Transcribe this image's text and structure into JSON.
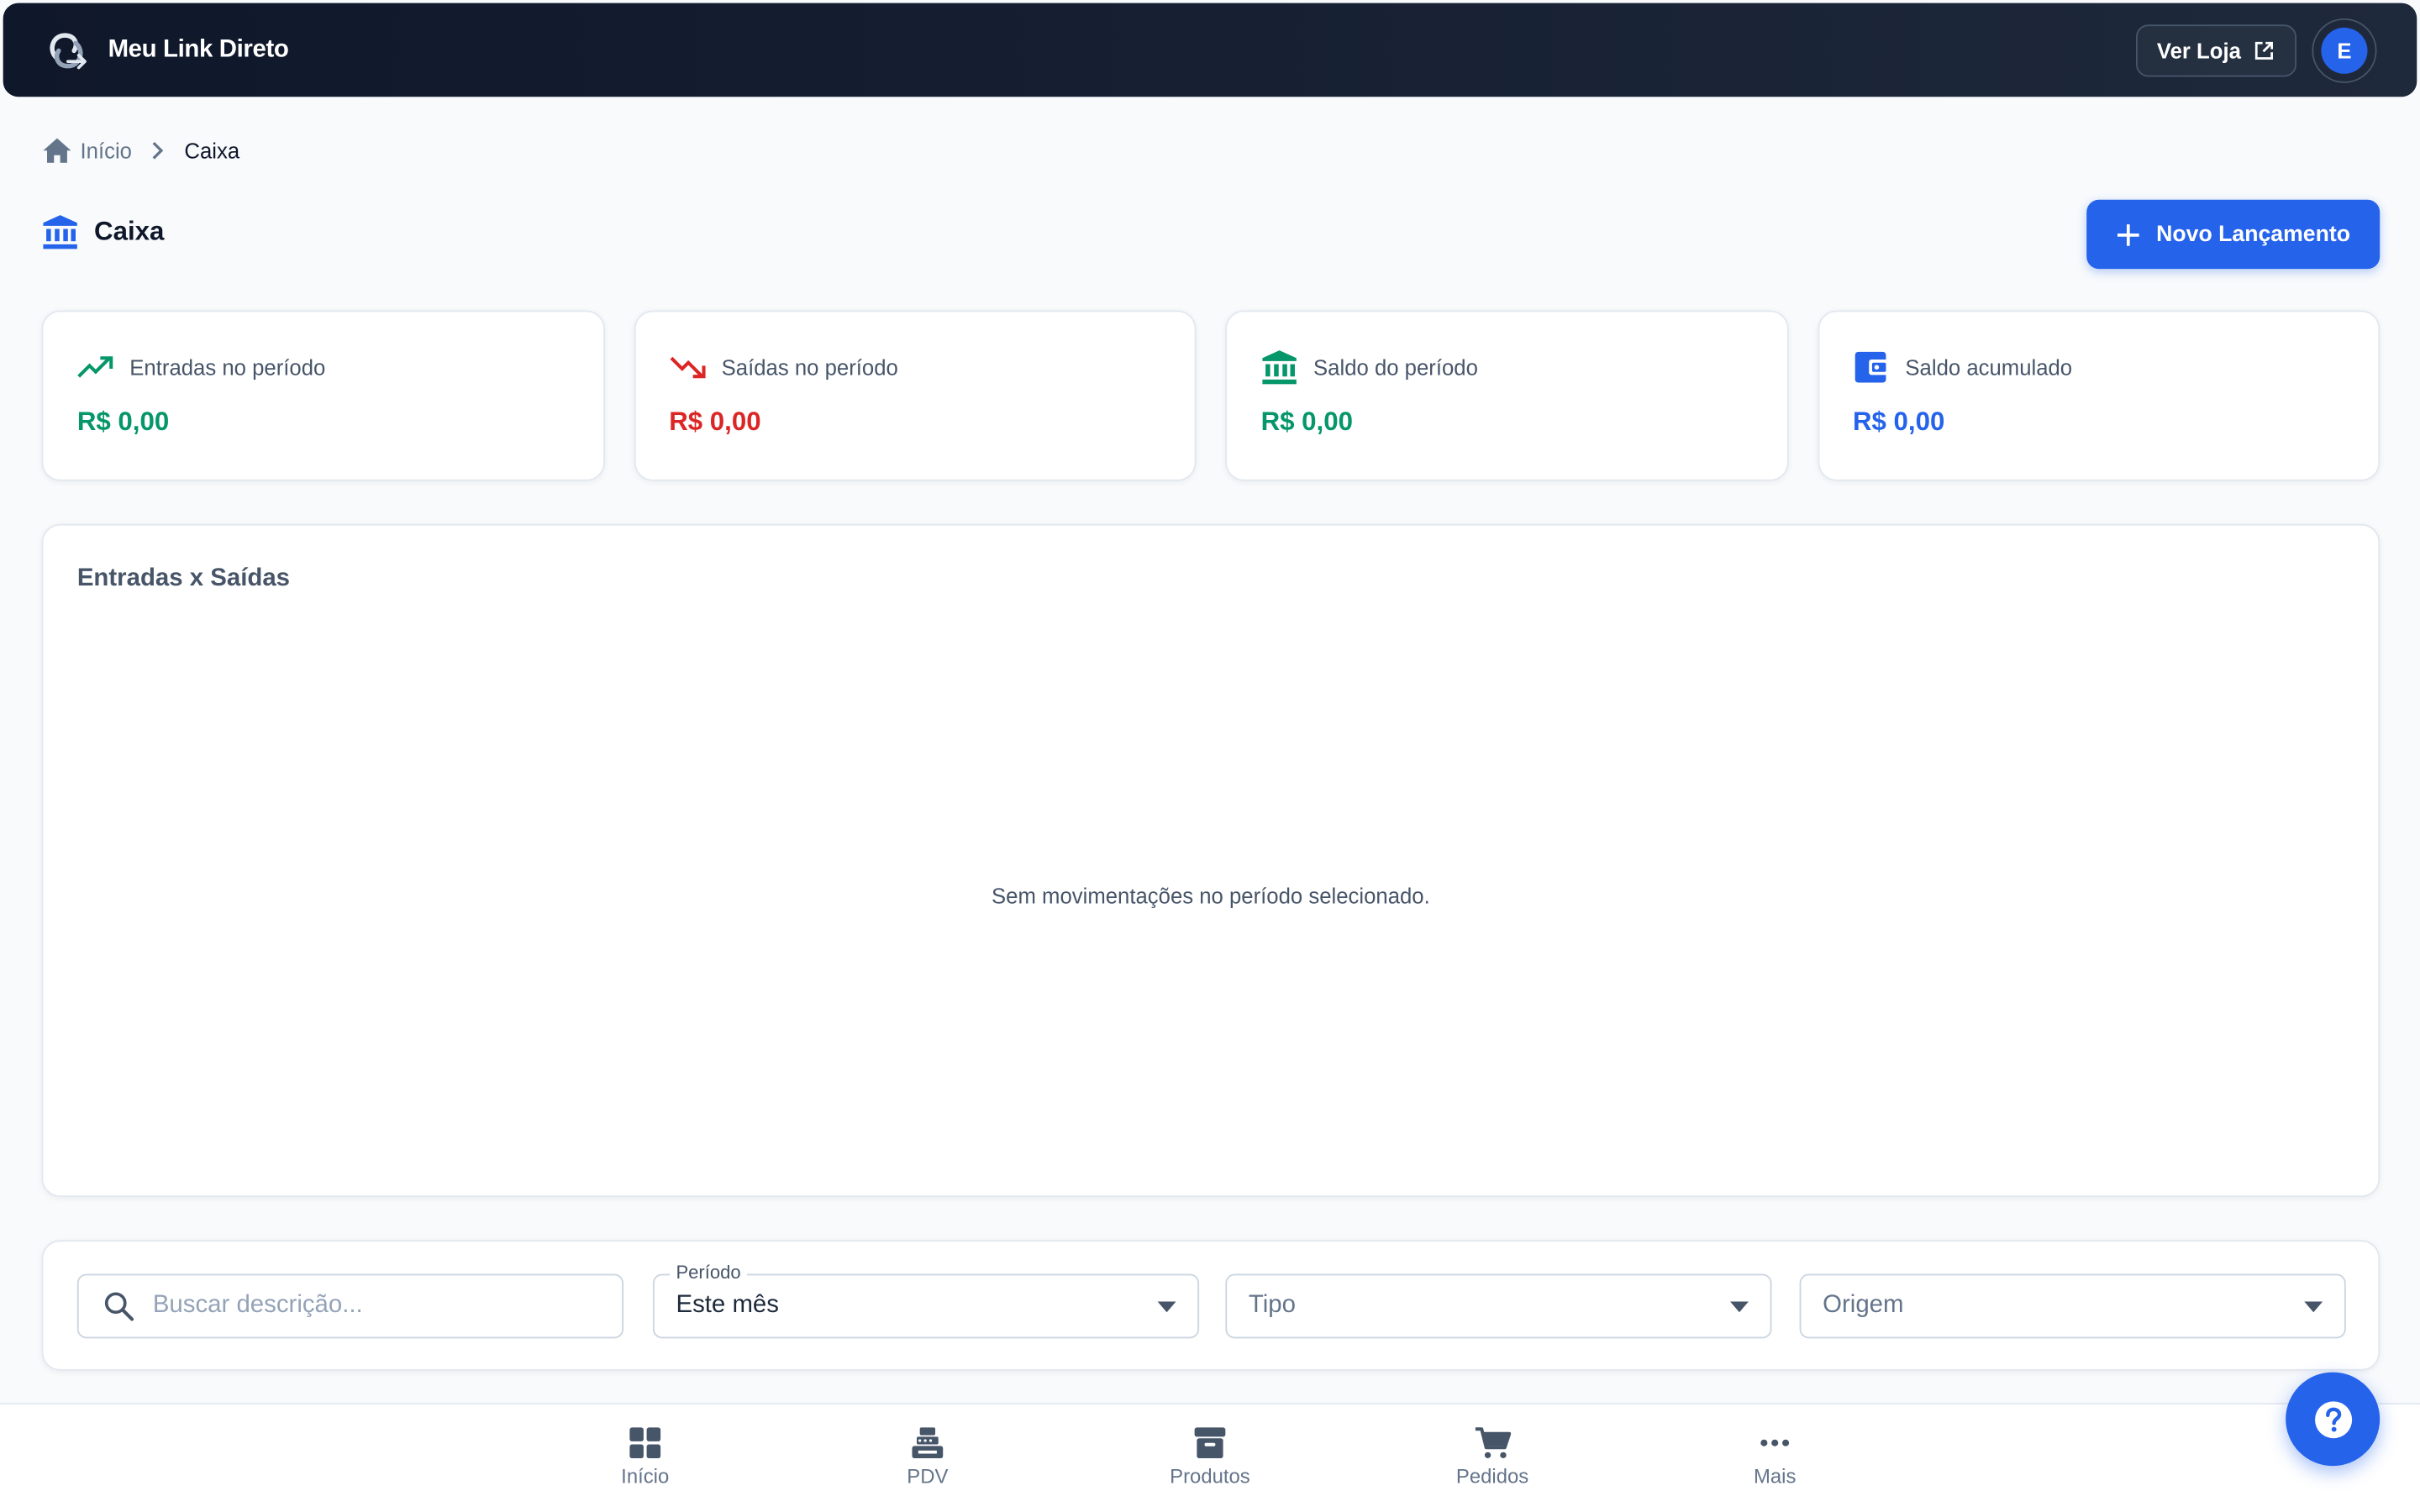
{
  "header": {
    "brand": "Meu Link Direto",
    "view_store_label": "Ver Loja",
    "avatar_initial": "E"
  },
  "breadcrumb": {
    "home": "Início",
    "current": "Caixa"
  },
  "page": {
    "title": "Caixa",
    "new_entry_label": "Novo Lançamento"
  },
  "cards": [
    {
      "label": "Entradas no período",
      "value": "R$ 0,00",
      "icon": "trending-up-icon",
      "color": "#059669"
    },
    {
      "label": "Saídas no período",
      "value": "R$ 0,00",
      "icon": "trending-down-icon",
      "color": "#dc2626"
    },
    {
      "label": "Saldo do período",
      "value": "R$ 0,00",
      "icon": "bank-icon",
      "color": "#059669"
    },
    {
      "label": "Saldo acumulado",
      "value": "R$ 0,00",
      "icon": "wallet-icon",
      "color": "#2563eb"
    }
  ],
  "chart": {
    "title": "Entradas x Saídas",
    "empty_message": "Sem movimentações no período selecionado."
  },
  "filters": {
    "search_placeholder": "Buscar descrição...",
    "period_label": "Período",
    "period_value": "Este mês",
    "type_placeholder": "Tipo",
    "origin_placeholder": "Origem"
  },
  "bottom_nav": [
    {
      "label": "Início",
      "icon": "dashboard-icon"
    },
    {
      "label": "PDV",
      "icon": "cash-register-icon"
    },
    {
      "label": "Produtos",
      "icon": "archive-box-icon"
    },
    {
      "label": "Pedidos",
      "icon": "cart-icon"
    },
    {
      "label": "Mais",
      "icon": "more-dots-icon"
    }
  ],
  "colors": {
    "accent": "#2563eb",
    "header_bg": "#0f172a",
    "positive": "#059669",
    "negative": "#dc2626"
  }
}
